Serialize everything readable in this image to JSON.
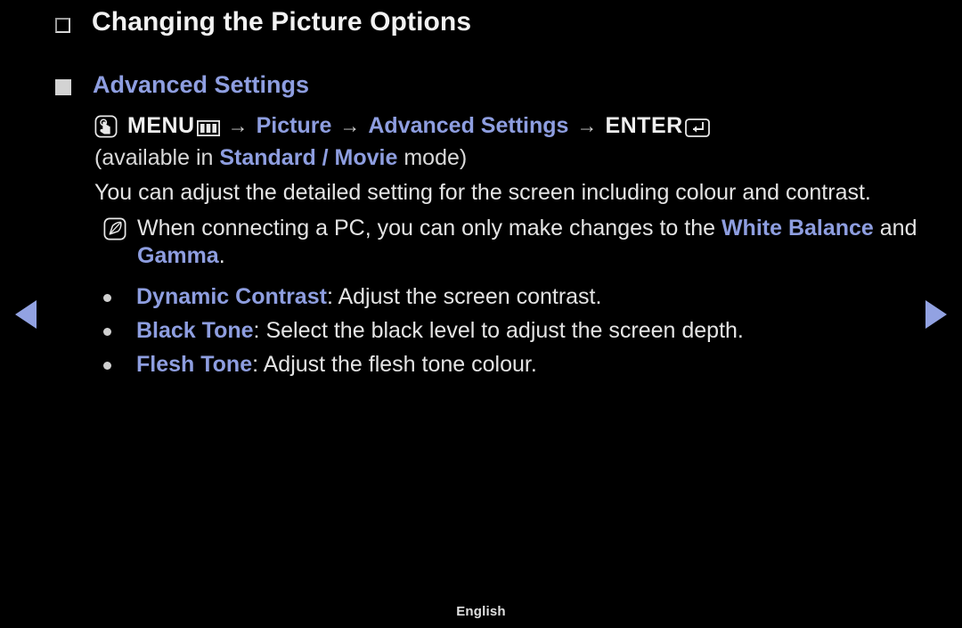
{
  "theme": {
    "background": "#000000",
    "text_color": "#e4e4e4",
    "accent_color": "#8e9ee0",
    "arrow_color": "#92a2e2",
    "bullet_color": "#d0d0d0"
  },
  "header": {
    "title": "Changing the Picture Options",
    "bullet_icon": "outlined-square-icon"
  },
  "section": {
    "title": "Advanced Settings",
    "bullet_icon": "filled-square-icon"
  },
  "menu_path": {
    "oo_icon": "hand-press-button-icon",
    "menu_label": "MENU",
    "menu_glyph_icon": "menu-grid-icon",
    "arrow": "→",
    "step_picture": "Picture",
    "step_advanced_settings": "Advanced Settings",
    "enter_label": "ENTER",
    "enter_glyph_icon": "enter-return-icon"
  },
  "availability": {
    "prefix": "(available in ",
    "modes": "Standard / Movie",
    "suffix": " mode)"
  },
  "description": "You can adjust the detailed setting for the screen including colour and contrast.",
  "note": {
    "icon": "note-pen-icon",
    "text_part1": "When connecting a PC, you can only make changes to the ",
    "emphasis1": "White Balance",
    "text_part2": " and ",
    "emphasis2": "Gamma",
    "text_part3": "."
  },
  "options": [
    {
      "name": "Dynamic Contrast",
      "separator": ": ",
      "description": "Adjust the screen contrast."
    },
    {
      "name": "Black Tone",
      "separator": ": ",
      "description": "Select the black level to adjust the screen depth."
    },
    {
      "name": "Flesh Tone",
      "separator": ": ",
      "description": "Adjust the flesh tone colour."
    }
  ],
  "navigation": {
    "prev_icon": "triangle-left-icon",
    "next_icon": "triangle-right-icon"
  },
  "footer": {
    "language": "English"
  }
}
